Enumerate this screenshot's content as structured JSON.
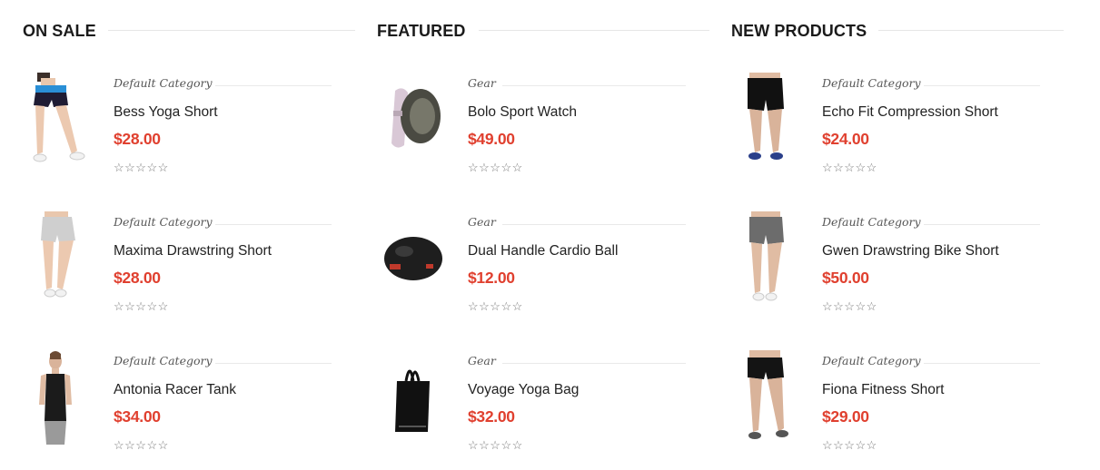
{
  "columns": [
    {
      "title": "ON SALE",
      "products": [
        {
          "category": "Default Category",
          "name": "Bess Yoga Short",
          "price": "$28.00",
          "rating": 0,
          "image_icon": "woman-yoga-shorts-icon"
        },
        {
          "category": "Default Category",
          "name": "Maxima Drawstring Short",
          "price": "$28.00",
          "rating": 0,
          "image_icon": "woman-grey-shorts-icon"
        },
        {
          "category": "Default Category",
          "name": "Antonia Racer Tank",
          "price": "$34.00",
          "rating": 0,
          "image_icon": "woman-racer-tank-icon"
        }
      ]
    },
    {
      "title": "FEATURED",
      "products": [
        {
          "category": "Gear",
          "name": "Bolo Sport Watch",
          "price": "$49.00",
          "rating": 0,
          "image_icon": "sport-watch-icon"
        },
        {
          "category": "Gear",
          "name": "Dual Handle Cardio Ball",
          "price": "$12.00",
          "rating": 0,
          "image_icon": "cardio-ball-icon"
        },
        {
          "category": "Gear",
          "name": "Voyage Yoga Bag",
          "price": "$32.00",
          "rating": 0,
          "image_icon": "yoga-bag-icon"
        }
      ]
    },
    {
      "title": "NEW PRODUCTS",
      "products": [
        {
          "category": "Default Category",
          "name": "Echo Fit Compression Short",
          "price": "$24.00",
          "rating": 0,
          "image_icon": "woman-compression-short-icon"
        },
        {
          "category": "Default Category",
          "name": "Gwen Drawstring Bike Short",
          "price": "$50.00",
          "rating": 0,
          "image_icon": "woman-bike-short-icon"
        },
        {
          "category": "Default Category",
          "name": "Fiona Fitness Short",
          "price": "$29.00",
          "rating": 0,
          "image_icon": "woman-fitness-short-icon"
        }
      ]
    }
  ],
  "rating_glyphs": "☆☆☆☆☆",
  "colors": {
    "price": "#e0402f",
    "divider": "#e6e6e6",
    "title": "#1b1b1b"
  }
}
